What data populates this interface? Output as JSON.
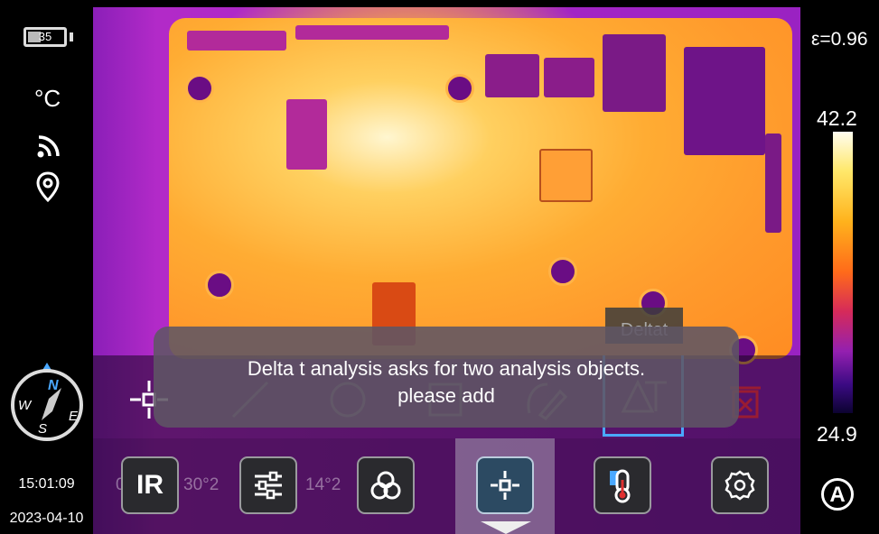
{
  "status": {
    "battery_level": "35",
    "unit": "°C",
    "time": "15:01:09",
    "date": "2023-04-10"
  },
  "compass": {
    "n": "N",
    "w": "W",
    "s": "S",
    "e": "E"
  },
  "right_panel": {
    "emissivity": "ε=0.96",
    "temp_max": "42.2",
    "temp_min": "24.9",
    "auto_label": "A"
  },
  "tools": {
    "deltat_label": "Deltat"
  },
  "toast": {
    "line1": "Delta t analysis asks for two analysis objects.",
    "line2": "please add"
  },
  "bottom_tabs": {
    "ir_label": "IR",
    "partial_1": "30°2",
    "partial_2": "14°2",
    "partial_3": "0"
  },
  "colors": {
    "accent": "#4aa8ff",
    "palette_top": "#fffdf0",
    "palette_bottom": "#0c0330"
  }
}
